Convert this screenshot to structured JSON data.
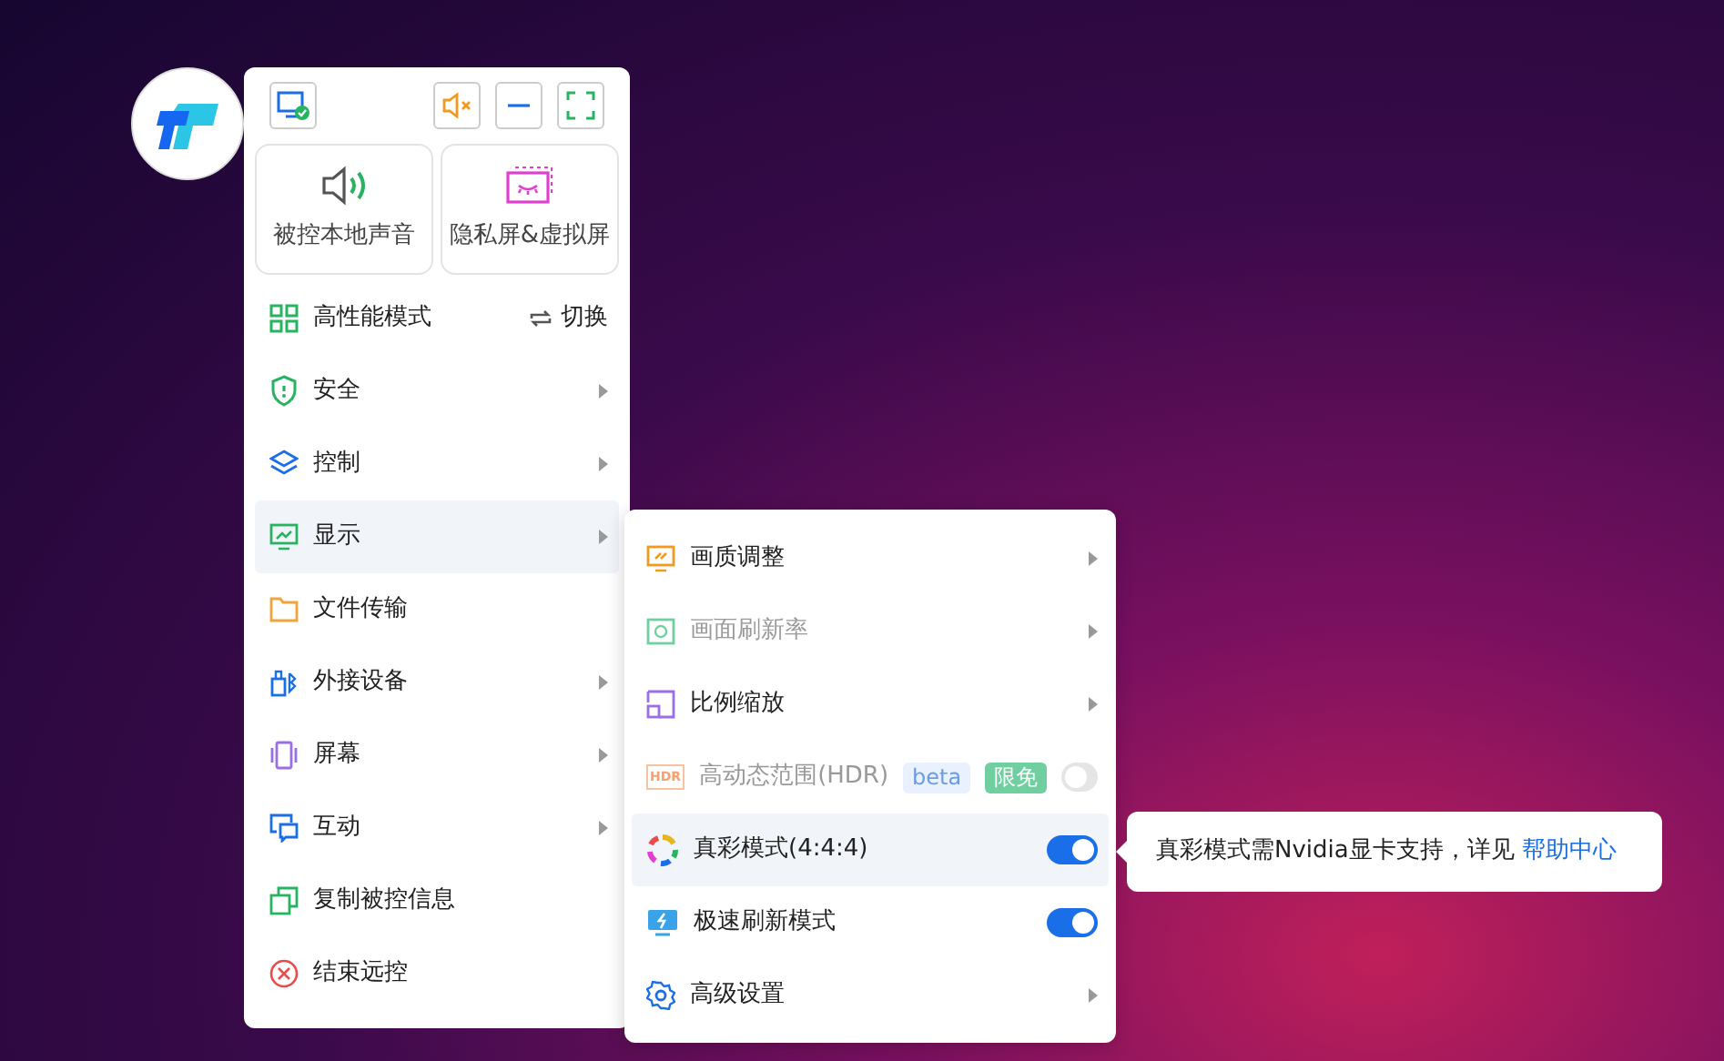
{
  "quick_buttons": [
    {
      "label": "被控本地声音"
    },
    {
      "label": "隐私屏&虚拟屏"
    }
  ],
  "menu": {
    "items": [
      {
        "label": "高性能模式",
        "kind": "action",
        "action": "切换",
        "selected": false
      },
      {
        "label": "安全",
        "kind": "submenu",
        "selected": false
      },
      {
        "label": "控制",
        "kind": "submenu",
        "selected": false
      },
      {
        "label": "显示",
        "kind": "submenu",
        "selected": true
      },
      {
        "label": "文件传输",
        "kind": "plain",
        "selected": false
      },
      {
        "label": "外接设备",
        "kind": "submenu",
        "selected": false
      },
      {
        "label": "屏幕",
        "kind": "submenu",
        "selected": false
      },
      {
        "label": "互动",
        "kind": "submenu",
        "selected": false
      },
      {
        "label": "复制被控信息",
        "kind": "plain",
        "selected": false
      },
      {
        "label": "结束远控",
        "kind": "plain",
        "selected": false
      }
    ]
  },
  "submenu": {
    "items": [
      {
        "label": "画质调整",
        "kind": "submenu",
        "disabled": false,
        "selected": false
      },
      {
        "label": "画面刷新率",
        "kind": "submenu",
        "disabled": true,
        "selected": false
      },
      {
        "label": "比例缩放",
        "kind": "submenu",
        "disabled": false,
        "selected": false
      },
      {
        "label": "高动态范围(HDR)",
        "icon_text": "HDR",
        "kind": "toggle",
        "disabled": true,
        "on": false,
        "selected": false,
        "badges": [
          {
            "text": "beta",
            "color": "#e8f1fd"
          },
          {
            "text": "限免",
            "color": "#6fcf9f"
          }
        ]
      },
      {
        "label": "真彩模式(4:4:4)",
        "kind": "toggle",
        "disabled": false,
        "on": true,
        "selected": true
      },
      {
        "label": "极速刷新模式",
        "kind": "toggle",
        "disabled": false,
        "on": true,
        "selected": false
      },
      {
        "label": "高级设置",
        "kind": "submenu",
        "disabled": false,
        "selected": false
      }
    ]
  },
  "tooltip": {
    "text": "真彩模式需Nvidia显卡支持，详见",
    "link": "帮助中心"
  }
}
